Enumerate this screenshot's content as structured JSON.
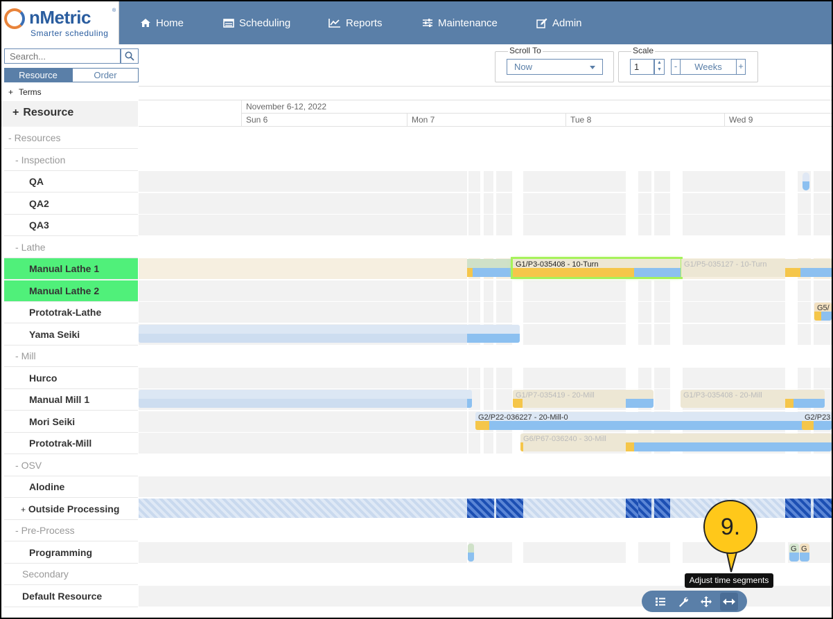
{
  "logo": {
    "brand": "nMetric",
    "tagline": "Smarter scheduling"
  },
  "nav": [
    {
      "label": "Home",
      "icon": "home-icon"
    },
    {
      "label": "Scheduling",
      "icon": "scheduling-icon"
    },
    {
      "label": "Reports",
      "icon": "chart-icon"
    },
    {
      "label": "Maintenance",
      "icon": "sliders-icon"
    },
    {
      "label": "Admin",
      "icon": "edit-icon"
    }
  ],
  "search": {
    "placeholder": "Search..."
  },
  "view_tabs": {
    "resource": "Resource",
    "order": "Order"
  },
  "terms_label": "Terms",
  "resource_header": "Resource",
  "scroll_to": {
    "label": "Scroll To",
    "value": "Now"
  },
  "scale": {
    "label": "Scale",
    "value": "1",
    "unit": "Weeks",
    "minus": "-",
    "plus": "+"
  },
  "timeline": {
    "week": "November 6-12, 2022",
    "days": [
      "Sun 6",
      "Mon 7",
      "Tue 8",
      "Wed 9"
    ]
  },
  "resources": [
    {
      "label": "Resources",
      "kind": "group",
      "prefix": "-"
    },
    {
      "label": "Inspection",
      "kind": "group",
      "prefix": "-"
    },
    {
      "label": "QA",
      "kind": "leaf"
    },
    {
      "label": "QA2",
      "kind": "leaf"
    },
    {
      "label": "QA3",
      "kind": "leaf"
    },
    {
      "label": "Lathe",
      "kind": "group",
      "prefix": "-"
    },
    {
      "label": "Manual Lathe 1",
      "kind": "leaf",
      "highlight": true
    },
    {
      "label": "Manual Lathe 2",
      "kind": "leaf",
      "highlight": true
    },
    {
      "label": "Prototrak-Lathe",
      "kind": "leaf"
    },
    {
      "label": "Yama Seiki",
      "kind": "leaf"
    },
    {
      "label": "Mill",
      "kind": "group",
      "prefix": "-"
    },
    {
      "label": "Hurco",
      "kind": "leaf"
    },
    {
      "label": "Manual Mill 1",
      "kind": "leaf"
    },
    {
      "label": "Mori Seiki",
      "kind": "leaf"
    },
    {
      "label": "Prototrak-Mill",
      "kind": "leaf"
    },
    {
      "label": "OSV",
      "kind": "group",
      "prefix": "-"
    },
    {
      "label": "Alodine",
      "kind": "leaf"
    },
    {
      "label": "Outside Processing",
      "kind": "leaf",
      "prefix": "+"
    },
    {
      "label": "Pre-Process",
      "kind": "group",
      "prefix": "-"
    },
    {
      "label": "Programming",
      "kind": "leaf"
    },
    {
      "label": "Secondary",
      "kind": "group"
    },
    {
      "label": "Default Resource",
      "kind": "leaf"
    }
  ],
  "tasks": {
    "lathe1_a": "G1/P3-035408 - 10-Turn",
    "lathe1_b": "G1/P5-035127 - 10-Turn",
    "proto_lathe": "G5/",
    "mill1_a": "G1/P7-035419 - 20-Mill",
    "mill1_b": "G1/P3-035408 - 20-Mill",
    "mori_a": "G2/P22-036227 - 20-Mill-0",
    "mori_b": "G2/P23",
    "protomill": "G6/P67-036240 - 30-Mill",
    "prog_a": "G",
    "prog_b": "G"
  },
  "colors": {
    "header": "#5a7fa8",
    "highlight": "#50f07a",
    "accent_yellow": "#ffc81a"
  },
  "callout": {
    "number": "9.",
    "tooltip": "Adjust time segments"
  },
  "toolbar": [
    {
      "icon": "list-icon"
    },
    {
      "icon": "wrench-icon"
    },
    {
      "icon": "move-icon"
    },
    {
      "icon": "resize-horizontal-icon"
    }
  ]
}
